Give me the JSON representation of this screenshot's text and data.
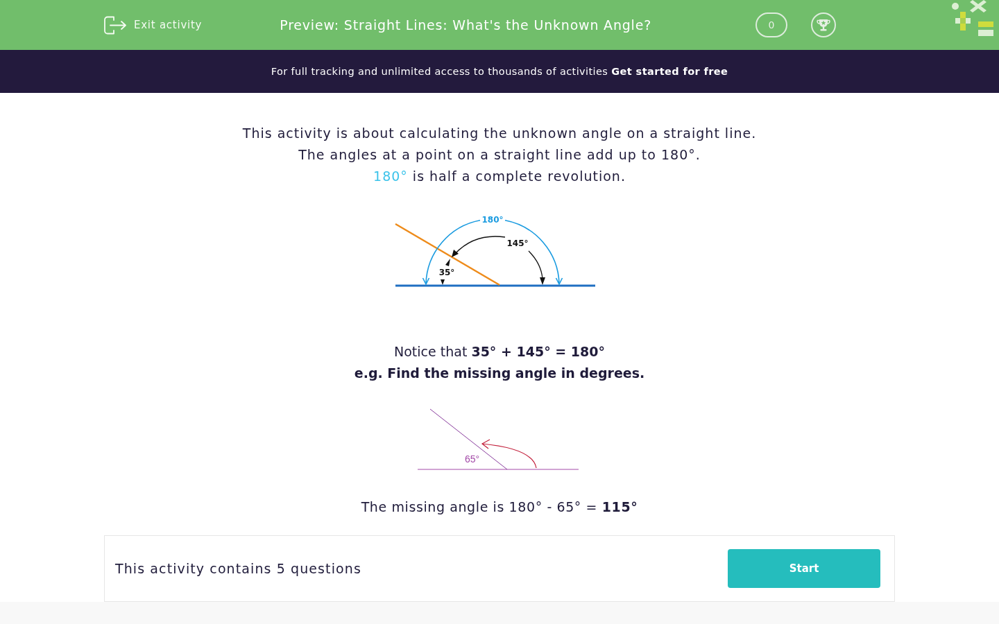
{
  "header": {
    "exit_label": "Exit activity",
    "title": "Preview: Straight Lines: What's the Unknown Angle?",
    "score": "0"
  },
  "banner": {
    "text": "For full tracking and unlimited access to thousands of activities",
    "link": "Get started for free"
  },
  "intro": {
    "lines": [
      "This activity is about calculating the unknown angle on a straight line.",
      "The angles at a point on a straight line add up to 180°."
    ],
    "highlight": "180°",
    "highlight_rest": "is half a complete revolution."
  },
  "diagram_1": {
    "labels": [
      {
        "kind": "total",
        "text": "180°"
      },
      {
        "kind": "large",
        "text": "145°"
      },
      {
        "kind": "small",
        "text": "35°"
      }
    ]
  },
  "notice": "Notice that **35° + 145° = 180°**",
  "example_prompt": "e.g. Find the missing angle in degrees.",
  "diagram_2": {
    "label": "65°"
  },
  "answer": "The missing angle is 180° - 65° = **115°**",
  "footer": {
    "summary": "This activity contains 5 questions",
    "start_label": "Start"
  }
}
